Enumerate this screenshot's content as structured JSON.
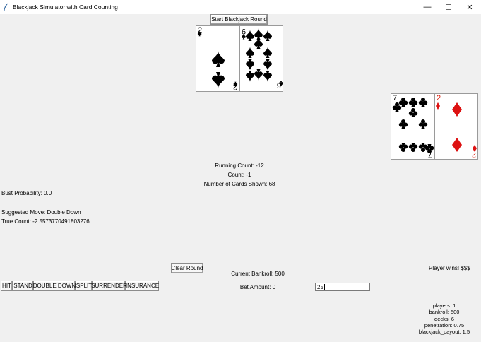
{
  "window": {
    "title": "Blackjack Simulator with Card Counting",
    "minimize_glyph": "—",
    "maximize_glyph": "☐",
    "close_glyph": "✕",
    "icon": "feather-icon"
  },
  "buttons": {
    "start_round": "Start Blackjack Round",
    "clear_round": "Clear Round",
    "hit": "HIT",
    "stand": "STAND",
    "double_down": "DOUBLE DOWN",
    "split": "SPLIT",
    "surrender": "SURRENDER",
    "insurance": "INSURANCE"
  },
  "dealer_hand": [
    {
      "rank": "2",
      "suit": "spades",
      "suit_glyph": "♠",
      "color": "#000000"
    },
    {
      "rank": "9",
      "suit": "spades",
      "suit_glyph": "♠",
      "color": "#000000"
    }
  ],
  "player_hand": [
    {
      "rank": "7",
      "suit": "clubs",
      "suit_glyph": "♣",
      "color": "#000000"
    },
    {
      "rank": "2",
      "suit": "diamonds",
      "suit_glyph": "♦",
      "color": "#dd1111"
    }
  ],
  "stats": {
    "running_count": "Running Count: -12",
    "count": "Count: -1",
    "cards_shown": "Number of Cards Shown: 68",
    "bust_probability": "Bust Probability: 0.0",
    "suggested_move": "Suggested Move: Double Down",
    "true_count": "True Count: -2.5573770491803276",
    "bankroll": "Current Bankroll: 500",
    "bet_amount_label": "Bet Amount: 0",
    "result": "Player wins! $$$"
  },
  "bet_input": {
    "value": "25"
  },
  "settings": {
    "players": "players: 1",
    "bankroll": "bankroll: 500",
    "decks": "decks: 6",
    "penetration": "penetration: 0.75",
    "blackjack_payout": "blackjack_payout: 1.5"
  }
}
